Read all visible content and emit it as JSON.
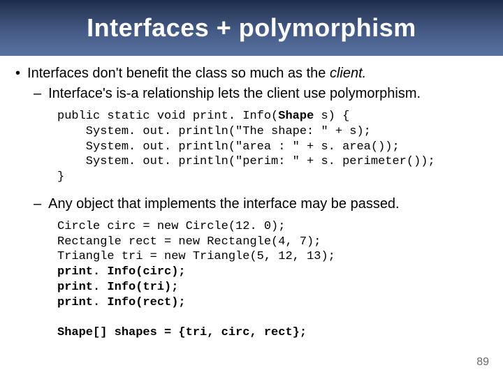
{
  "title": "Interfaces + polymorphism",
  "bullet": {
    "pre": "Interfaces don't benefit the class so much as the ",
    "em": "client.",
    "post": ""
  },
  "sub1": "Interface's is-a relationship lets the client use polymorphism.",
  "code1": {
    "l1a": "public static void print. Info(",
    "l1b": "Shape",
    "l1c": " s) {",
    "l2": "    System. out. println(\"The shape: \" + s);",
    "l3": "    System. out. println(\"area : \" + s. area());",
    "l4": "    System. out. println(\"perim: \" + s. perimeter());",
    "l5": "}"
  },
  "sub2": "Any object that implements the interface may be passed.",
  "code2": {
    "l1": "Circle circ = new Circle(12. 0);",
    "l2": "Rectangle rect = new Rectangle(4, 7);",
    "l3": "Triangle tri = new Triangle(5, 12, 13);",
    "l4": "print. Info(circ);",
    "l5": "print. Info(tri);",
    "l6": "print. Info(rect);",
    "blank": "",
    "l7": "Shape[] shapes = {tri, circ, rect};"
  },
  "page_number": "89"
}
